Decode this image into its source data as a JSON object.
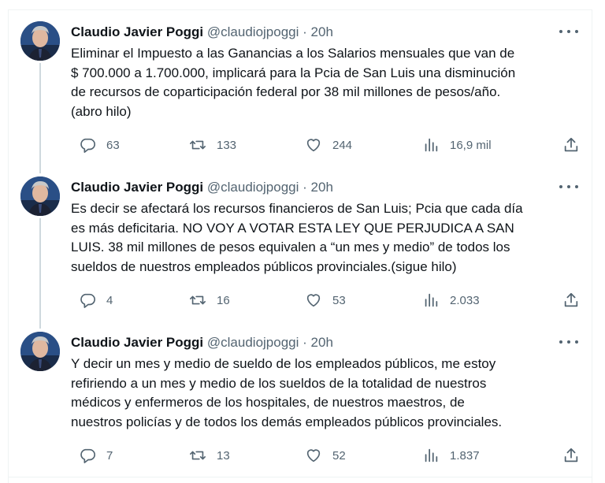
{
  "tweets": [
    {
      "name": "Claudio Javier Poggi",
      "handle": "@claudiojpoggi",
      "sep": "·",
      "time": "20h",
      "text": "Eliminar el Impuesto a las Ganancias a los Salarios mensuales que van de\n$ 700.000 a 1.700.000, implicará para la Pcia de San Luis una disminución\nde recursos de coparticipación federal por 38 mil millones de pesos/año.\n(abro hilo)",
      "replies": "63",
      "retweets": "133",
      "likes": "244",
      "views": "16,9 mil"
    },
    {
      "name": "Claudio Javier Poggi",
      "handle": "@claudiojpoggi",
      "sep": "·",
      "time": "20h",
      "text": "Es decir se afectará los recursos financieros de San Luis; Pcia que cada día\nes más deficitaria. NO VOY A VOTAR ESTA LEY QUE PERJUDICA A SAN\nLUIS. 38 mil millones de pesos equivalen a “un mes y medio” de todos los\nsueldos de nuestros empleados públicos provinciales.(sigue hilo)",
      "replies": "4",
      "retweets": "16",
      "likes": "53",
      "views": "2.033"
    },
    {
      "name": "Claudio Javier Poggi",
      "handle": "@claudiojpoggi",
      "sep": "·",
      "time": "20h",
      "text": "Y decir un mes y medio de sueldo de los empleados públicos, me estoy\nrefiriendo a un mes y medio de los sueldos de la totalidad de nuestros\nmédicos y enfermeros de los hospitales, de nuestros maestros, de\nnuestros policías y de todos los demás empleados públicos provinciales.",
      "replies": "7",
      "retweets": "13",
      "likes": "52",
      "views": "1.837"
    }
  ],
  "icons": {
    "reply": "reply-icon",
    "retweet": "retweet-icon",
    "like": "heart-icon",
    "views": "views-chart-icon",
    "share": "share-icon",
    "more": "more-icon"
  },
  "colors": {
    "text": "#0f1419",
    "secondary": "#536471",
    "thread_line": "#cfd9de",
    "border": "#eff3f4"
  }
}
